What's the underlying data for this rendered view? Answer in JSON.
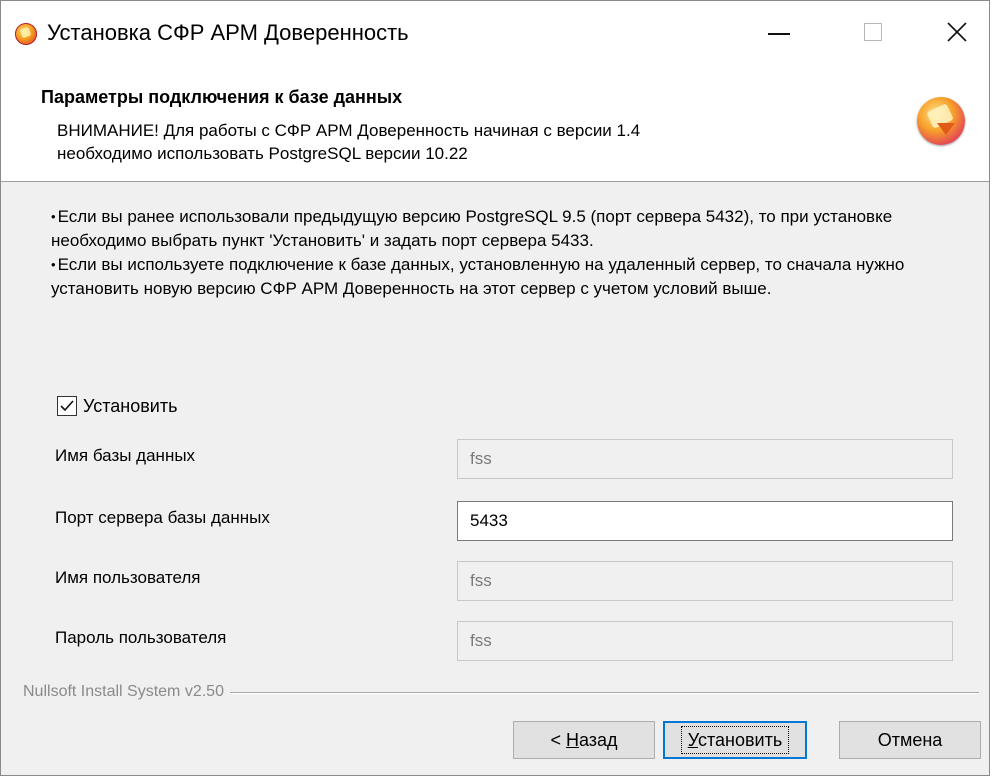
{
  "window": {
    "title": "Установка СФР АРМ Доверенность"
  },
  "header": {
    "title": "Параметры подключения к базе данных",
    "desc_line1": "ВНИМАНИЕ! Для работы с СФР АРМ Доверенность начиная с версии 1.4",
    "desc_line2": "необходимо использовать PostgreSQL версии 10.22"
  },
  "info": {
    "bullet": "•",
    "paragraph1": "Если вы ранее использовали предыдущую версию PostgreSQL 9.5 (порт сервера 5432), то при установке необходимо выбрать пункт 'Установить' и задать порт сервера 5433.",
    "paragraph2": "Если вы используете подключение к базе данных, установленную на удаленный сервер, то сначала нужно установить новую версию СФР АРМ Доверенность на этот сервер с учетом условий выше."
  },
  "install_checkbox": {
    "label": "Установить",
    "checked": true
  },
  "fields": [
    {
      "label": "Имя базы данных",
      "value": "fss",
      "enabled": false
    },
    {
      "label": "Порт сервера базы данных",
      "value": "5433",
      "enabled": true
    },
    {
      "label": "Имя пользователя",
      "value": "fss",
      "enabled": false
    },
    {
      "label": "Пароль пользователя",
      "value": "fss",
      "enabled": false
    }
  ],
  "footer": {
    "branding": "Nullsoft Install System v2.50",
    "back_prefix": "< ",
    "back_hotkey": "Н",
    "back_rest": "азад",
    "install_hotkey": "У",
    "install_rest": "становить",
    "cancel_label": "Отмена"
  }
}
